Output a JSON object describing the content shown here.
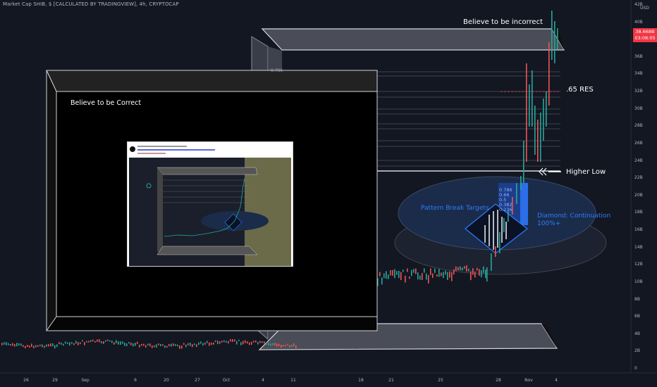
{
  "header": {
    "title": "Market Cap SHIB, $ [CALCULATED BY TRADINGVIEW], 4h, CRYPTOCAP"
  },
  "annotations": {
    "believe_incorrect": "Believe to be incorrect",
    "believe_correct": "Believe to be Correct",
    "res_65": ".65 RES",
    "higher_low": "Higher Low",
    "pattern_break": "Pattern Break Targets",
    "diamond_line1": "Diamond: Continuation",
    "diamond_line2": "100%+",
    "fib_top": "0.786",
    "fib_levels": [
      "0.786",
      "0.66",
      "0.5",
      "0.382",
      "0.236"
    ]
  },
  "price_scale": {
    "unit": "USD",
    "ticks": [
      "42B",
      "40B",
      "38B",
      "36B",
      "34B",
      "32B",
      "30B",
      "28B",
      "26B",
      "24B",
      "22B",
      "20B",
      "18B",
      "16B",
      "14B",
      "12B",
      "10B",
      "8B",
      "6B",
      "4B",
      "2B",
      "0"
    ],
    "current_price": "38.668B",
    "countdown": "03:08:05"
  },
  "time_scale": {
    "ticks": [
      "26",
      "29",
      "Sep",
      "6",
      "20",
      "27",
      "Oct",
      "4",
      "11",
      "18",
      "21",
      "25",
      "28",
      "Nov",
      "4"
    ]
  },
  "colors": {
    "background": "#131722",
    "bull": "#26a69a",
    "bear": "#ef5350",
    "annotation_blue": "#2f7bff",
    "price_tag": "#f23645"
  },
  "inset": {
    "kind": "screenshot-thumbnail"
  }
}
